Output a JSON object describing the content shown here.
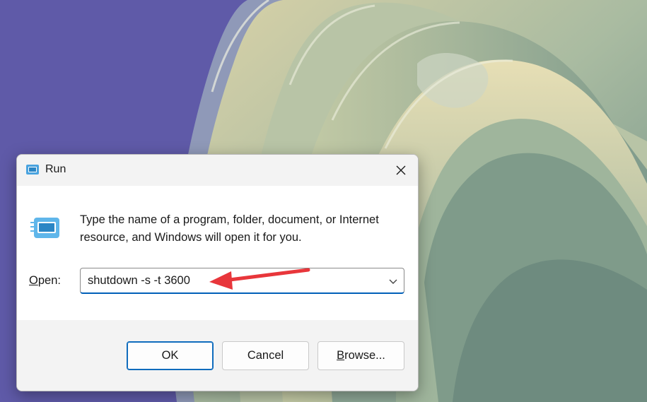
{
  "window": {
    "title": "Run",
    "icon": "run-app-icon",
    "close_icon": "close-icon"
  },
  "description": "Type the name of a program, folder, document, or Internet resource, and Windows will open it for you.",
  "open_field": {
    "label_mnemonic": "O",
    "label_rest": "pen:",
    "value": "shutdown -s -t 3600"
  },
  "buttons": {
    "ok": "OK",
    "cancel": "Cancel",
    "browse_mnemonic": "B",
    "browse_rest": "rowse..."
  },
  "annotation": {
    "arrow_color": "#e8363b"
  },
  "colors": {
    "accent": "#005fb8",
    "wallpaper_left": "#5f5aa8"
  }
}
